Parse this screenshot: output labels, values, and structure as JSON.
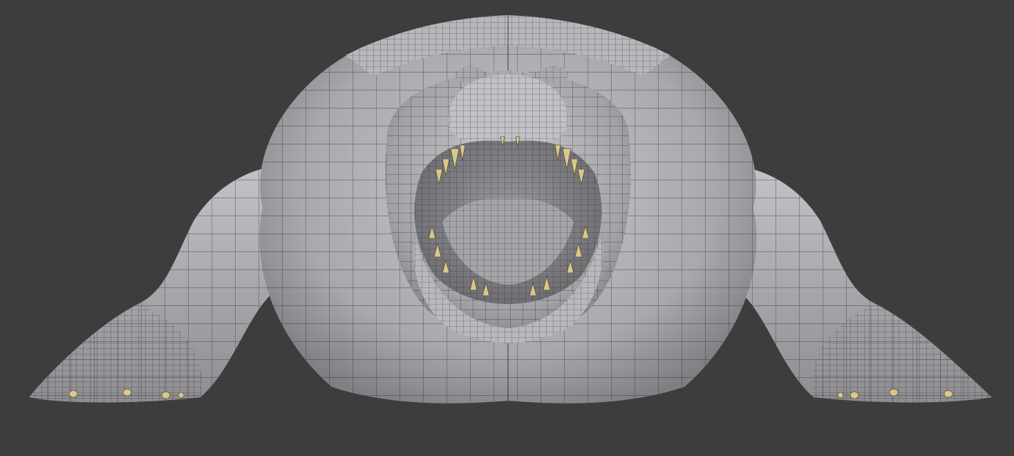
{
  "viewport": {
    "background_color": "#3d3d3d",
    "subject": "wireframe-mesh-creature",
    "colors": {
      "mesh_light": "#c4c4c8",
      "mesh_mid": "#a6a6aa",
      "mesh_dark": "#7c7c80",
      "wire": "#1c1c1e",
      "teeth": "#d8c890",
      "mouth_inner": "#8a8a8e"
    },
    "shading": "solid-with-wireframe-overlay"
  }
}
